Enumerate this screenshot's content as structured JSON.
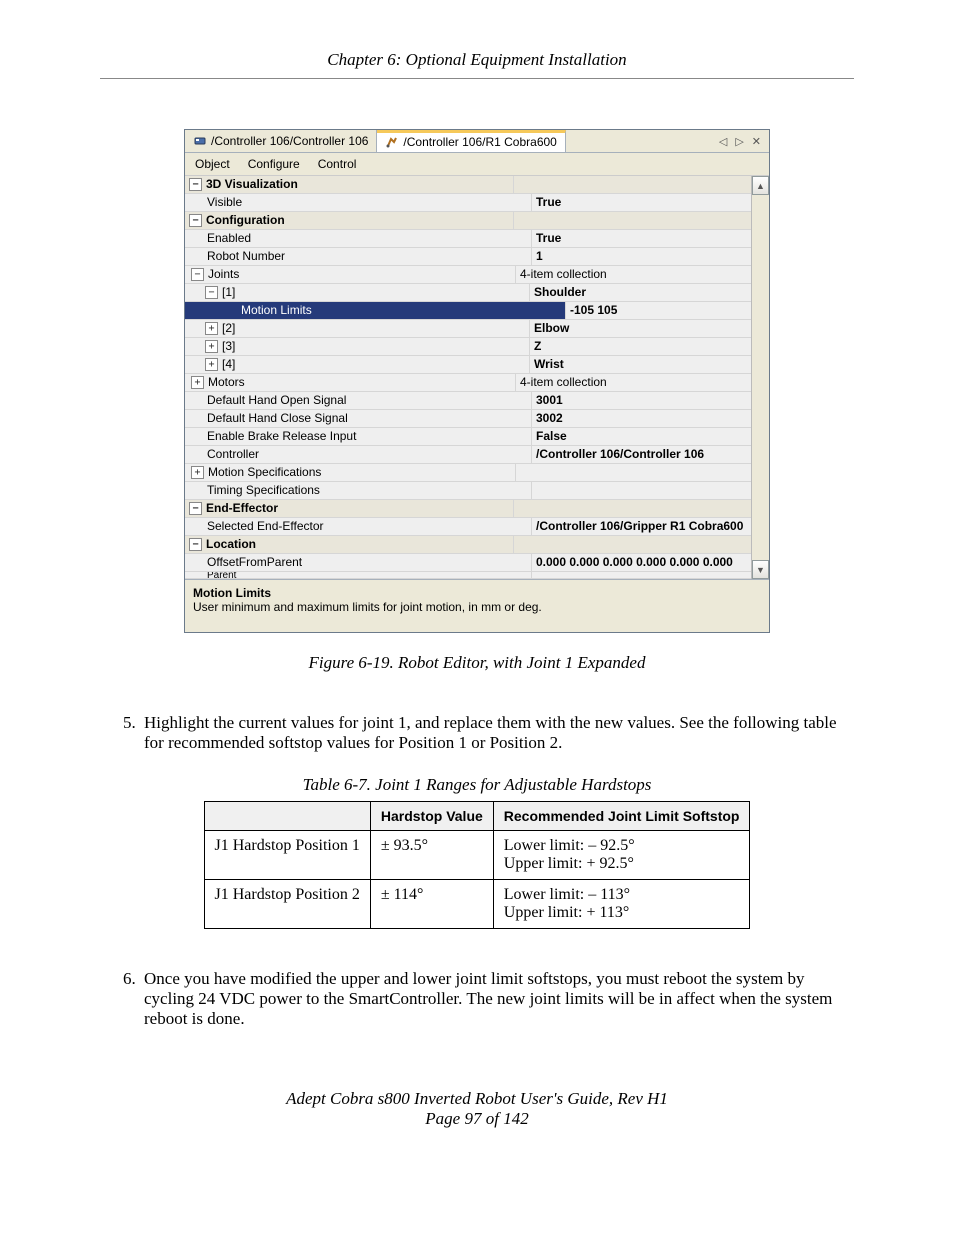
{
  "chapter": "Chapter 6: Optional Equipment Installation",
  "tabs": {
    "t0": "/Controller 106/Controller 106",
    "t1": "/Controller 106/R1 Cobra600"
  },
  "tab_controls": {
    "left": "◁",
    "right": "▷",
    "close": "✕"
  },
  "menu": {
    "m0": "Object",
    "m1": "Configure",
    "m2": "Control"
  },
  "prop": {
    "vis3d_cat": "3D Visualization",
    "visible_l": "Visible",
    "visible_v": "True",
    "config_cat": "Configuration",
    "enabled_l": "Enabled",
    "enabled_v": "True",
    "robotnum_l": "Robot Number",
    "robotnum_v": "1",
    "joints_l": "Joints",
    "joints_v": "4-item collection",
    "j1_l": "[1]",
    "j1_v": "Shoulder",
    "motionlimits_l": "Motion Limits",
    "motionlimits_v": "-105 105",
    "j2_l": "[2]",
    "j2_v": "Elbow",
    "j3_l": "[3]",
    "j3_v": "Z",
    "j4_l": "[4]",
    "j4_v": "Wrist",
    "motors_l": "Motors",
    "motors_v": "4-item collection",
    "dho_l": "Default Hand Open Signal",
    "dho_v": "3001",
    "dhc_l": "Default Hand Close Signal",
    "dhc_v": "3002",
    "brake_l": "Enable Brake Release Input",
    "brake_v": "False",
    "ctrl_l": "Controller",
    "ctrl_v": "/Controller 106/Controller 106",
    "mspec_l": "Motion Specifications",
    "mspec_v": "",
    "tspec_l": "Timing Specifications",
    "tspec_v": "",
    "endeff_cat": "End-Effector",
    "selend_l": "Selected End-Effector",
    "selend_v": "/Controller 106/Gripper R1 Cobra600",
    "loc_cat": "Location",
    "offset_l": "OffsetFromParent",
    "offset_v": "0.000 0.000 0.000 0.000 0.000 0.000",
    "parent_l": "Parent"
  },
  "desc": {
    "title": "Motion Limits",
    "body": "User minimum and maximum limits for joint motion, in mm or deg."
  },
  "scroll": {
    "up": "▲",
    "down": "▼"
  },
  "fig": "Figure 6-19. Robot Editor, with Joint 1 Expanded",
  "step5": "Highlight the current values for joint 1, and replace them with the new values. See the following table for recommended softstop values for Position 1 or Position 2.",
  "tablecap": "Table 6-7. Joint 1 Ranges for Adjustable Hardstops",
  "tbl": {
    "h1": "Hardstop Value",
    "h2": "Recommended Joint Limit Softstop",
    "r1c0": "J1 Hardstop Position 1",
    "r1c1": "± 93.5°",
    "r1c2a": "Lower limit: – 92.5°",
    "r1c2b": "Upper limit: + 92.5°",
    "r2c0": "J1 Hardstop Position 2",
    "r2c1": "± 114°",
    "r2c2a": "Lower limit: – 113°",
    "r2c2b": "Upper limit: + 113°"
  },
  "step6": "Once you have modified the upper and lower joint limit softstops, you must reboot the system by cycling 24 VDC power to the SmartController. The new joint limits will be in affect when the system reboot is done.",
  "footer1": "Adept Cobra s800 Inverted Robot User's Guide, Rev H1",
  "footer2": "Page 97 of 142"
}
